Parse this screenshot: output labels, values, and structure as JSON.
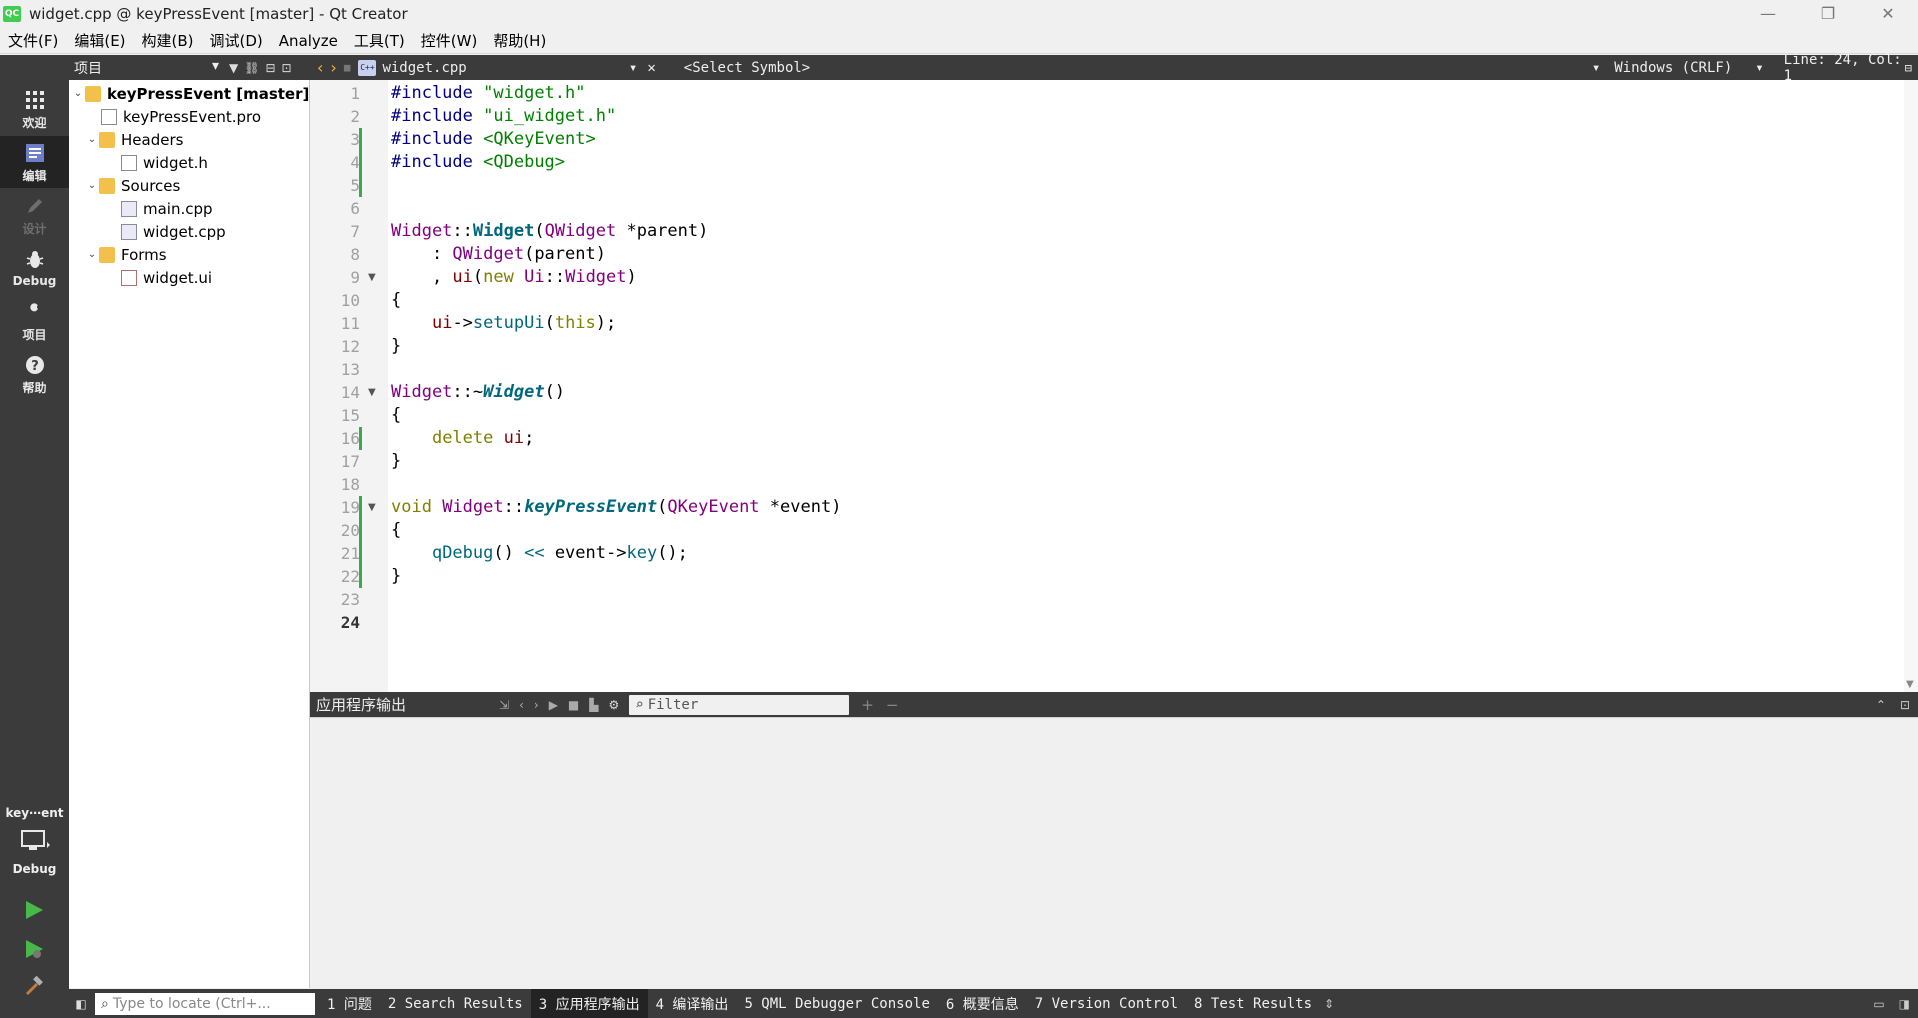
{
  "window": {
    "title": "widget.cpp @ keyPressEvent [master] - Qt Creator",
    "logo": "QC",
    "minimize": "—",
    "restore": "❐",
    "close": "✕"
  },
  "menu": [
    "文件(F)",
    "编辑(E)",
    "构建(B)",
    "调试(D)",
    "Analyze",
    "工具(T)",
    "控件(W)",
    "帮助(H)"
  ],
  "modes": [
    {
      "label": "欢迎",
      "icon": "grid-icon"
    },
    {
      "label": "编辑",
      "icon": "edit-icon"
    },
    {
      "label": "设计",
      "icon": "design-icon"
    },
    {
      "label": "Debug",
      "icon": "bug-icon"
    },
    {
      "label": "项目",
      "icon": "wrench-icon"
    },
    {
      "label": "帮助",
      "icon": "help-icon"
    }
  ],
  "project_panel": {
    "combo_label": "项目",
    "tree": [
      {
        "label": "keyPressEvent [master]",
        "level": 0,
        "expanded": true,
        "type": "project"
      },
      {
        "label": "keyPressEvent.pro",
        "level": 1,
        "type": "pro"
      },
      {
        "label": "Headers",
        "level": 1,
        "expanded": true,
        "type": "folder"
      },
      {
        "label": "widget.h",
        "level": 2,
        "type": "header"
      },
      {
        "label": "Sources",
        "level": 1,
        "expanded": true,
        "type": "folder"
      },
      {
        "label": "main.cpp",
        "level": 2,
        "type": "cpp"
      },
      {
        "label": "widget.cpp",
        "level": 2,
        "type": "cpp"
      },
      {
        "label": "Forms",
        "level": 1,
        "expanded": true,
        "type": "folder"
      },
      {
        "label": "widget.ui",
        "level": 2,
        "type": "ui"
      }
    ]
  },
  "editor_toolbar": {
    "file": "widget.cpp",
    "symbol": "<Select Symbol>",
    "encoding": "Windows (CRLF)",
    "position": "Line: 24, Col: 1"
  },
  "editor": {
    "current_line": 24,
    "lines": [
      "#include \"widget.h\"",
      "#include \"ui_widget.h\"",
      "#include <QKeyEvent>",
      "#include <QDebug>",
      "",
      "",
      "Widget::Widget(QWidget *parent)",
      "    : QWidget(parent)",
      "    , ui(new Ui::Widget)",
      "{",
      "    ui->setupUi(this);",
      "}",
      "",
      "Widget::~Widget()",
      "{",
      "    delete ui;",
      "}",
      "",
      "void Widget::keyPressEvent(QKeyEvent *event)",
      "{",
      "    qDebug() << event->key();",
      "}",
      "",
      ""
    ],
    "modified_lines": [
      3,
      4,
      5,
      16,
      19,
      20,
      21,
      22
    ],
    "fold_lines": [
      9,
      14,
      19
    ]
  },
  "output": {
    "title": "应用程序输出",
    "filter_placeholder": "Filter"
  },
  "statusbar": {
    "locator_placeholder": "Type to locate (Ctrl+...",
    "tabs": [
      {
        "label": "1 问题",
        "active": false
      },
      {
        "label": "2 Search Results",
        "active": false
      },
      {
        "label": "3 应用程序输出",
        "active": true
      },
      {
        "label": "4 编译输出",
        "active": false
      },
      {
        "label": "5 QML Debugger Console",
        "active": false
      },
      {
        "label": "6 概要信息",
        "active": false
      },
      {
        "label": "7 Version Control",
        "active": false
      },
      {
        "label": "8 Test Results",
        "active": false
      }
    ]
  },
  "run_panel": {
    "kit": "key⋯ent",
    "mode": "Debug"
  },
  "colors": {
    "sidebar_bg": "#3b3b3b",
    "active_mode_bg": "#232323",
    "modified_marker": "#3aa94a",
    "run_green": "#48b848"
  }
}
